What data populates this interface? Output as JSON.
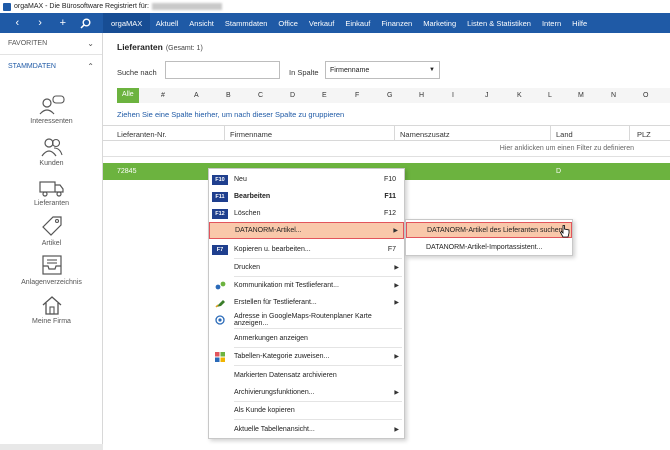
{
  "window": {
    "title": "orgaMAX - Die Bürosoftware Registriert für:"
  },
  "nav": {
    "back": "‹",
    "forward": "›",
    "add": "+",
    "search": "⌕"
  },
  "menu": [
    "orgaMAX",
    "Aktuell",
    "Ansicht",
    "Stammdaten",
    "Office",
    "Verkauf",
    "Einkauf",
    "Finanzen",
    "Marketing",
    "Listen & Statistiken",
    "Intern",
    "Hilfe"
  ],
  "sidebar": {
    "favoriten": "FAVORITEN",
    "stammdaten": "STAMMDATEN",
    "items": [
      "Interessenten",
      "Kunden",
      "Lieferanten",
      "Artikel",
      "Anlagenverzeichnis",
      "Meine Firma"
    ]
  },
  "page": {
    "title": "Lieferanten",
    "count": "(Gesamt: 1)",
    "search_label": "Suche nach",
    "in_spalte_label": "In Spalte",
    "column_value": "Firmenname",
    "alphabet": [
      "Alle",
      "#",
      "A",
      "B",
      "C",
      "D",
      "E",
      "F",
      "G",
      "H",
      "I",
      "J",
      "K",
      "L",
      "M",
      "N",
      "O"
    ],
    "group_hint": "Ziehen Sie eine Spalte hierher, um nach dieser Spalte zu gruppieren",
    "columns": [
      "Lieferanten-Nr.",
      "Firmenname",
      "Namenszusatz",
      "Land",
      "PLZ"
    ],
    "filter_hint": "Hier anklicken um einen Filter zu definieren",
    "row": {
      "nr": "72845",
      "land": "D"
    }
  },
  "context_menu": {
    "items": [
      {
        "key": "F10",
        "label": "Neu",
        "shortcut": "F10"
      },
      {
        "key": "F11",
        "label": "Bearbeiten",
        "shortcut": "F11"
      },
      {
        "key": "F12",
        "label": "Löschen",
        "shortcut": "F12"
      },
      {
        "label": "DATANORM-Artikel..."
      },
      {
        "key": "F7",
        "label": "Kopieren u. bearbeiten...",
        "shortcut": "F7"
      },
      {
        "label": "Drucken"
      },
      {
        "label": "Kommunikation mit Testlieferant..."
      },
      {
        "label": "Erstellen für Testlieferant..."
      },
      {
        "label": "Adresse in GoogleMaps-Routenplaner Karte anzeigen..."
      },
      {
        "label": "Anmerkungen anzeigen"
      },
      {
        "label": "Tabellen-Kategorie zuweisen..."
      },
      {
        "label": "Markierten Datensatz archivieren"
      },
      {
        "label": "Archivierungsfunktionen..."
      },
      {
        "label": "Als Kunde kopieren"
      },
      {
        "label": "Aktuelle Tabellenansicht..."
      }
    ]
  },
  "submenu": {
    "items": [
      "DATANORM-Artikel des Lieferanten suchen...",
      "DATANORM-Artikel-Importassistent..."
    ]
  },
  "colors": {
    "brand": "#1f5aa6",
    "selection": "#6cb33f",
    "highlight": "#f9c8aa",
    "highlight_border": "#e2555c"
  }
}
